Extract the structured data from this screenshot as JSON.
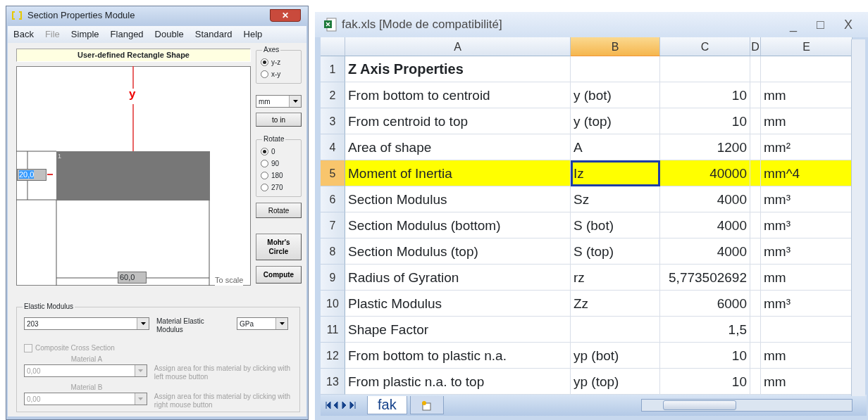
{
  "section_window": {
    "title": "Section Properties Module",
    "close_glyph": "✕",
    "menu": [
      {
        "label": "Back",
        "disabled": false
      },
      {
        "label": "File",
        "disabled": true
      },
      {
        "label": "Simple",
        "disabled": false
      },
      {
        "label": "Flanged",
        "disabled": false
      },
      {
        "label": "Double",
        "disabled": false
      },
      {
        "label": "Standard",
        "disabled": false
      },
      {
        "label": "Help",
        "disabled": false
      }
    ],
    "shape_title": "User-defined Rectangle Shape",
    "canvas": {
      "y_axis_label": "y",
      "part_number": "1",
      "height_value": "20,0",
      "height_value_highlighted": true,
      "width_value": "60,0",
      "scale_note": "To scale"
    },
    "axes": {
      "title": "Axes",
      "options": [
        {
          "label": "y-z",
          "selected": true
        },
        {
          "label": "x-y",
          "selected": false
        }
      ]
    },
    "unit": "mm",
    "convert_button": "to in",
    "rotate": {
      "title": "Rotate",
      "options": [
        {
          "label": "0",
          "selected": true
        },
        {
          "label": "90",
          "selected": false
        },
        {
          "label": "180",
          "selected": false
        },
        {
          "label": "270",
          "selected": false
        }
      ]
    },
    "buttons": [
      "Rotate",
      "Mohr's Circle",
      "Compute"
    ],
    "elastic_modulus": {
      "title": "Elastic Modulus",
      "value": "203",
      "label": "Material Elastic Modulus",
      "unit": "GPa"
    },
    "composite": {
      "label": "Composite Cross Section",
      "checked": false,
      "disabled": true
    },
    "materials": [
      {
        "title": "Material A",
        "value": "0,00",
        "hint": "Assign area for this material by clicking with left mouse button",
        "disabled": true
      },
      {
        "title": "Material B",
        "value": "0,00",
        "hint": "Assign area for this material by clicking with right mouse button",
        "disabled": true
      }
    ]
  },
  "spreadsheet": {
    "title": "fak.xls  [Mode de compatibilité]",
    "window_controls": [
      "_",
      "□",
      "X"
    ],
    "columns": [
      {
        "label": "A",
        "selected": false
      },
      {
        "label": "B",
        "selected": true
      },
      {
        "label": "C",
        "selected": false
      },
      {
        "label": "D",
        "selected": false
      },
      {
        "label": "E",
        "selected": false
      }
    ],
    "rows": [
      {
        "number": "1",
        "cells": [
          "Z Axis Properties",
          "",
          "",
          "",
          ""
        ],
        "kind": "heading",
        "highlighted": false,
        "cell_selected": [
          false,
          false,
          false,
          false,
          false
        ]
      },
      {
        "number": "2",
        "cells": [
          "From bottom to centroid",
          "y (bot)",
          "10",
          "",
          "mm"
        ],
        "kind": "data",
        "highlighted": false,
        "cell_selected": [
          false,
          false,
          false,
          false,
          false
        ]
      },
      {
        "number": "3",
        "cells": [
          "From centroid to top",
          "y (top)",
          "10",
          "",
          "mm"
        ],
        "kind": "data",
        "highlighted": false,
        "cell_selected": [
          false,
          false,
          false,
          false,
          false
        ]
      },
      {
        "number": "4",
        "cells": [
          "Area of shape",
          "A",
          "1200",
          "",
          "mm²"
        ],
        "kind": "data",
        "highlighted": false,
        "cell_selected": [
          false,
          false,
          false,
          false,
          false
        ]
      },
      {
        "number": "5",
        "cells": [
          "Moment of Inertia",
          "Iz",
          "40000",
          "",
          "mm^4"
        ],
        "kind": "data",
        "highlighted": true,
        "cell_selected": [
          false,
          true,
          false,
          false,
          false
        ]
      },
      {
        "number": "6",
        "cells": [
          "Section Modulus",
          "Sz",
          "4000",
          "",
          "mm³"
        ],
        "kind": "data",
        "highlighted": false,
        "cell_selected": [
          false,
          false,
          false,
          false,
          false
        ]
      },
      {
        "number": "7",
        "cells": [
          "Section Modulus (bottom)",
          "S (bot)",
          "4000",
          "",
          "mm³"
        ],
        "kind": "data",
        "highlighted": false,
        "cell_selected": [
          false,
          false,
          false,
          false,
          false
        ]
      },
      {
        "number": "8",
        "cells": [
          "Section Modulus (top)",
          "S (top)",
          "4000",
          "",
          "mm³"
        ],
        "kind": "data",
        "highlighted": false,
        "cell_selected": [
          false,
          false,
          false,
          false,
          false
        ]
      },
      {
        "number": "9",
        "cells": [
          "Radius of Gyration",
          "rz",
          "5,773502692",
          "",
          "mm"
        ],
        "kind": "data",
        "highlighted": false,
        "cell_selected": [
          false,
          false,
          false,
          false,
          false
        ]
      },
      {
        "number": "10",
        "cells": [
          "Plastic Modulus",
          "Zz",
          "6000",
          "",
          "mm³"
        ],
        "kind": "data",
        "highlighted": false,
        "cell_selected": [
          false,
          false,
          false,
          false,
          false
        ]
      },
      {
        "number": "11",
        "cells": [
          "Shape Factor",
          "",
          "1,5",
          "",
          ""
        ],
        "kind": "data",
        "highlighted": false,
        "cell_selected": [
          false,
          false,
          false,
          false,
          false
        ]
      },
      {
        "number": "12",
        "cells": [
          "From bottom to plastic n.a.",
          "yp (bot)",
          "10",
          "",
          "mm"
        ],
        "kind": "data",
        "highlighted": false,
        "cell_selected": [
          false,
          false,
          false,
          false,
          false
        ]
      },
      {
        "number": "13",
        "cells": [
          "From plastic n.a. to top",
          "yp (top)",
          "10",
          "",
          "mm"
        ],
        "kind": "data",
        "highlighted": false,
        "cell_selected": [
          false,
          false,
          false,
          false,
          false
        ]
      }
    ],
    "sheet_tabs": [
      {
        "label": "fak",
        "selected": true
      }
    ]
  }
}
